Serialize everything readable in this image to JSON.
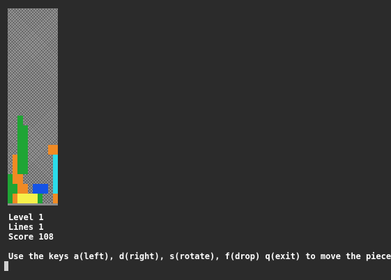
{
  "colors": {
    "background": "#2b2b2b",
    "text": "#ffffff",
    "G": "#1fa535",
    "O": "#f08a24",
    "C": "#2bdcea",
    "B": "#1453e6",
    "Y": "#f6f04a",
    "R": "#d62e1e"
  },
  "board": {
    "columns": 10,
    "rows": 20,
    "grid": [
      "..........",
      "..........",
      "..........",
      "..........",
      "..........",
      "..........",
      "..........",
      "..........",
      "..........",
      "..........",
      "..........",
      "..G.......",
      "..GG......",
      "..GG......",
      "..GG....OO",
      ".OGG.....C",
      ".OGG.....C",
      "GOO......C",
      "GGOO.BBB.C",
      "GOYYYYG..O"
    ]
  },
  "stats": {
    "level": "Level 1",
    "lines": "Lines 1",
    "score": "Score 108"
  },
  "instructions": "Use the keys a(left), d(right), s(rotate), f(drop) q(exit) to move the pieces:"
}
